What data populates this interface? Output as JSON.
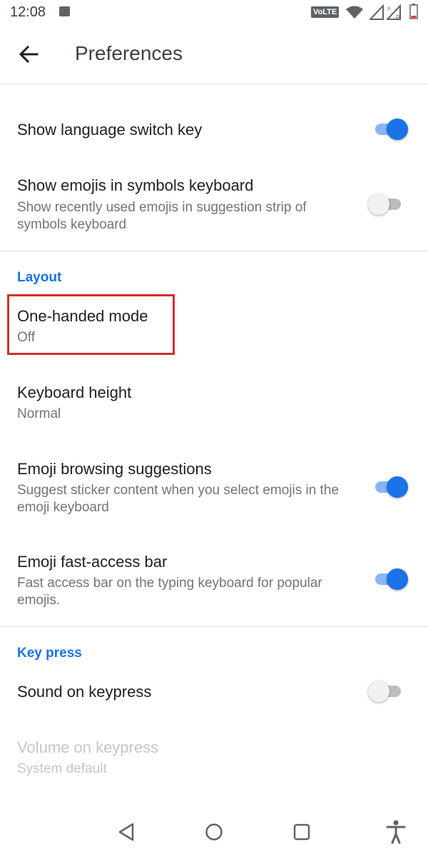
{
  "status_bar": {
    "time": "12:08",
    "network_badge": "VoLTE"
  },
  "app_bar": {
    "title": "Preferences",
    "back_icon": "arrow-back-icon"
  },
  "prefs": {
    "show_language_switch": {
      "title": "Show language switch key",
      "enabled": true
    },
    "show_emojis_symbols": {
      "title": "Show emojis in symbols keyboard",
      "summary": "Show recently used emojis in suggestion strip of symbols keyboard",
      "enabled": false
    },
    "layout_header": "Layout",
    "one_handed": {
      "title": "One-handed mode",
      "summary": "Off"
    },
    "keyboard_height": {
      "title": "Keyboard height",
      "summary": "Normal"
    },
    "emoji_browsing": {
      "title": "Emoji browsing suggestions",
      "summary": "Suggest sticker content when you select emojis in the emoji keyboard",
      "enabled": true
    },
    "emoji_fast_access": {
      "title": "Emoji fast-access bar",
      "summary": "Fast access bar on the typing keyboard for popular emojis.",
      "enabled": true
    },
    "keypress_header": "Key press",
    "sound_keypress": {
      "title": "Sound on keypress",
      "enabled": false
    },
    "volume_keypress": {
      "title": "Volume on keypress",
      "summary": "System default"
    }
  },
  "colors": {
    "accent": "#1a73e8",
    "highlight": "#d32f2f"
  }
}
